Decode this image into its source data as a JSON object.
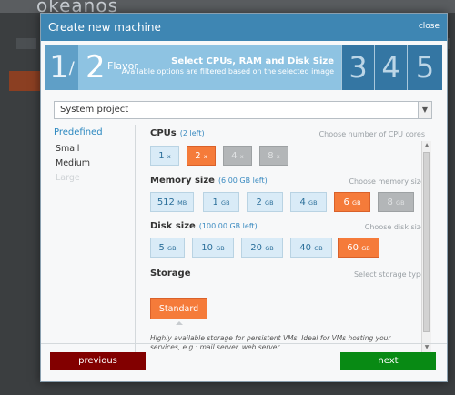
{
  "background": {
    "logo": "okeanos"
  },
  "modal": {
    "title": "Create new machine",
    "close_label": "close"
  },
  "wizard": {
    "previous_step": "1",
    "previous_step_sep": "/",
    "current_step_number": "2",
    "current_step_name": "Flavor",
    "current_step_title": "Select CPUs, RAM and Disk Size",
    "current_step_subtitle": "Available options are filtered based on the selected image",
    "future_steps": [
      "3",
      "4",
      "5"
    ]
  },
  "project_select": {
    "value": "System project"
  },
  "predefined": {
    "title": "Predefined",
    "items": [
      {
        "label": "Small",
        "enabled": true
      },
      {
        "label": "Medium",
        "enabled": true
      },
      {
        "label": "Large",
        "enabled": false
      }
    ]
  },
  "cpus": {
    "label": "CPUs",
    "note": "(2 left)",
    "hint": "Choose number of CPU cores",
    "options": [
      {
        "value": "1",
        "unit": "x",
        "state": "available"
      },
      {
        "value": "2",
        "unit": "x",
        "state": "selected"
      },
      {
        "value": "4",
        "unit": "x",
        "state": "disabled"
      },
      {
        "value": "8",
        "unit": "x",
        "state": "disabled"
      }
    ]
  },
  "memory": {
    "label": "Memory size",
    "note": "(6.00 GB left)",
    "hint": "Choose memory size",
    "options": [
      {
        "value": "512",
        "unit": "MB",
        "state": "available"
      },
      {
        "value": "1",
        "unit": "GB",
        "state": "available"
      },
      {
        "value": "2",
        "unit": "GB",
        "state": "available"
      },
      {
        "value": "4",
        "unit": "GB",
        "state": "available"
      },
      {
        "value": "6",
        "unit": "GB",
        "state": "selected"
      },
      {
        "value": "8",
        "unit": "GB",
        "state": "disabled"
      }
    ]
  },
  "disk": {
    "label": "Disk size",
    "note": "(100.00 GB left)",
    "hint": "Choose disk size",
    "options": [
      {
        "value": "5",
        "unit": "GB",
        "state": "available"
      },
      {
        "value": "10",
        "unit": "GB",
        "state": "available"
      },
      {
        "value": "20",
        "unit": "GB",
        "state": "available"
      },
      {
        "value": "40",
        "unit": "GB",
        "state": "available"
      },
      {
        "value": "60",
        "unit": "GB",
        "state": "selected"
      }
    ]
  },
  "storage": {
    "label": "Storage",
    "hint": "Select storage type",
    "selected": "Standard",
    "description": "Highly available storage for persistent VMs. Ideal for VMs hosting your services, e.g.: mail server, web server."
  },
  "footer": {
    "previous_label": "previous",
    "next_label": "next"
  },
  "colors": {
    "header_blue": "#3e86b3",
    "selected_orange": "#f57b3a",
    "option_blue": "#d9ebf7",
    "previous_red": "#820000",
    "next_green": "#088a14"
  }
}
